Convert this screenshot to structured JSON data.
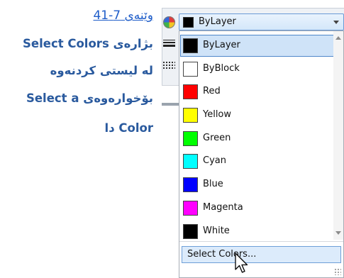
{
  "caption": {
    "figure_label": "وێنەی 7-41",
    "lines": [
      "بژارەی Select Colors",
      "لە لیستی کردنەوە",
      "بۆخوارەوەی  Select a",
      "Color دا"
    ]
  },
  "combo": {
    "selected_label": "ByLayer",
    "selected_color": "#000000"
  },
  "dropdown": {
    "items": [
      {
        "label": "ByLayer",
        "color": "#000000",
        "selected": true
      },
      {
        "label": "ByBlock",
        "color": "#ffffff"
      },
      {
        "label": "Red",
        "color": "#ff0000"
      },
      {
        "label": "Yellow",
        "color": "#ffff00"
      },
      {
        "label": "Green",
        "color": "#00ff00"
      },
      {
        "label": "Cyan",
        "color": "#00ffff"
      },
      {
        "label": "Blue",
        "color": "#0000ff"
      },
      {
        "label": "Magenta",
        "color": "#ff00ff"
      },
      {
        "label": "White",
        "color": "#000000"
      }
    ],
    "select_colors_label": "Select Colors..."
  },
  "colors": {
    "caption_text": "#2a5a9e",
    "caption_link": "#1f5dc9",
    "highlight": "#cfe3f8",
    "highlight_border": "#4f86c9"
  },
  "icons": {
    "panel": [
      "color-wheel-icon",
      "lineweight-icon",
      "linetype-icon"
    ],
    "combo_arrow": "chevron-down-icon",
    "cursor": "mouse-pointer-icon"
  }
}
